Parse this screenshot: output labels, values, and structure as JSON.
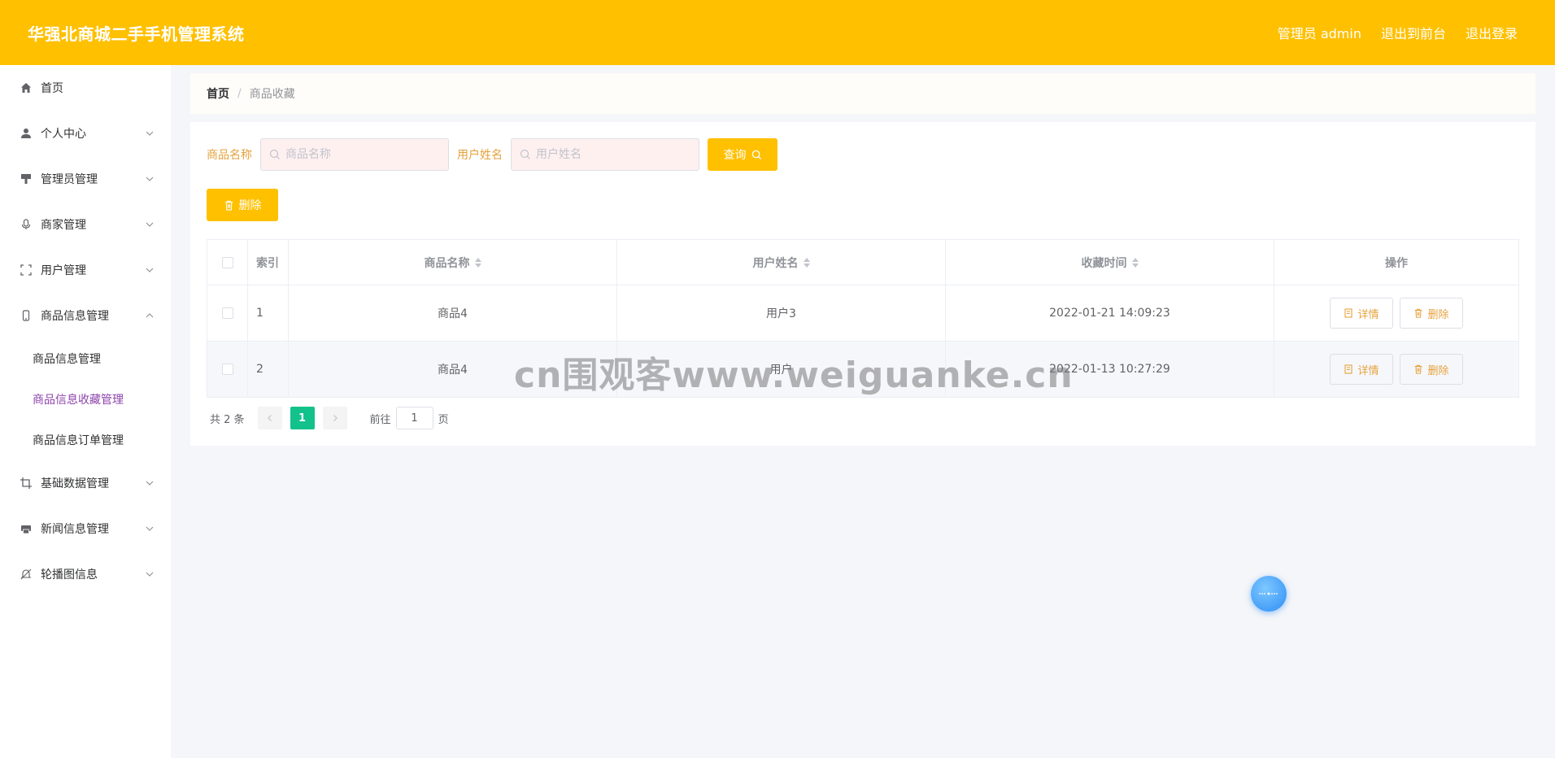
{
  "header": {
    "title": "华强北商城二手手机管理系统",
    "admin_label": "管理员 admin",
    "to_front": "退出到前台",
    "logout": "退出登录"
  },
  "sidebar": {
    "items": [
      {
        "label": "首页",
        "icon": "home-icon"
      },
      {
        "label": "个人中心",
        "icon": "user-icon"
      },
      {
        "label": "管理员管理",
        "icon": "brush-icon"
      },
      {
        "label": "商家管理",
        "icon": "microphone-icon"
      },
      {
        "label": "用户管理",
        "icon": "fullscreen-icon"
      },
      {
        "label": "商品信息管理",
        "icon": "phone-icon"
      },
      {
        "label": "基础数据管理",
        "icon": "crop-icon"
      },
      {
        "label": "新闻信息管理",
        "icon": "printer-icon"
      },
      {
        "label": "轮播图信息",
        "icon": "bell-off-icon"
      }
    ],
    "submenu": [
      {
        "label": "商品信息管理"
      },
      {
        "label": "商品信息收藏管理"
      },
      {
        "label": "商品信息订单管理"
      }
    ]
  },
  "breadcrumb": {
    "home": "首页",
    "separator": "/",
    "current": "商品收藏"
  },
  "search": {
    "product_label": "商品名称",
    "product_placeholder": "商品名称",
    "user_label": "用户姓名",
    "user_placeholder": "用户姓名",
    "query_button": "查询"
  },
  "toolbar": {
    "delete_button": "删除"
  },
  "table": {
    "headers": {
      "index": "索引",
      "product": "商品名称",
      "user": "用户姓名",
      "time": "收藏时间",
      "ops": "操作"
    },
    "rows": [
      {
        "index": "1",
        "product": "商品4",
        "user": "用户3",
        "time": "2022-01-21 14:09:23"
      },
      {
        "index": "2",
        "product": "商品4",
        "user": "用户",
        "time": "2022-01-13 10:27:29"
      }
    ],
    "detail_button": "详情",
    "delete_button": "删除"
  },
  "pagination": {
    "total": "共 2 条",
    "current_page": "1",
    "goto_label": "前往",
    "goto_value": "1",
    "page_suffix": "页"
  },
  "watermark": "cn围观客www.weiguanke.cn",
  "colors": {
    "accent": "#ffc000",
    "label": "#e6a23c",
    "active_page": "#13c28a",
    "active_menu": "#8e44ad"
  }
}
